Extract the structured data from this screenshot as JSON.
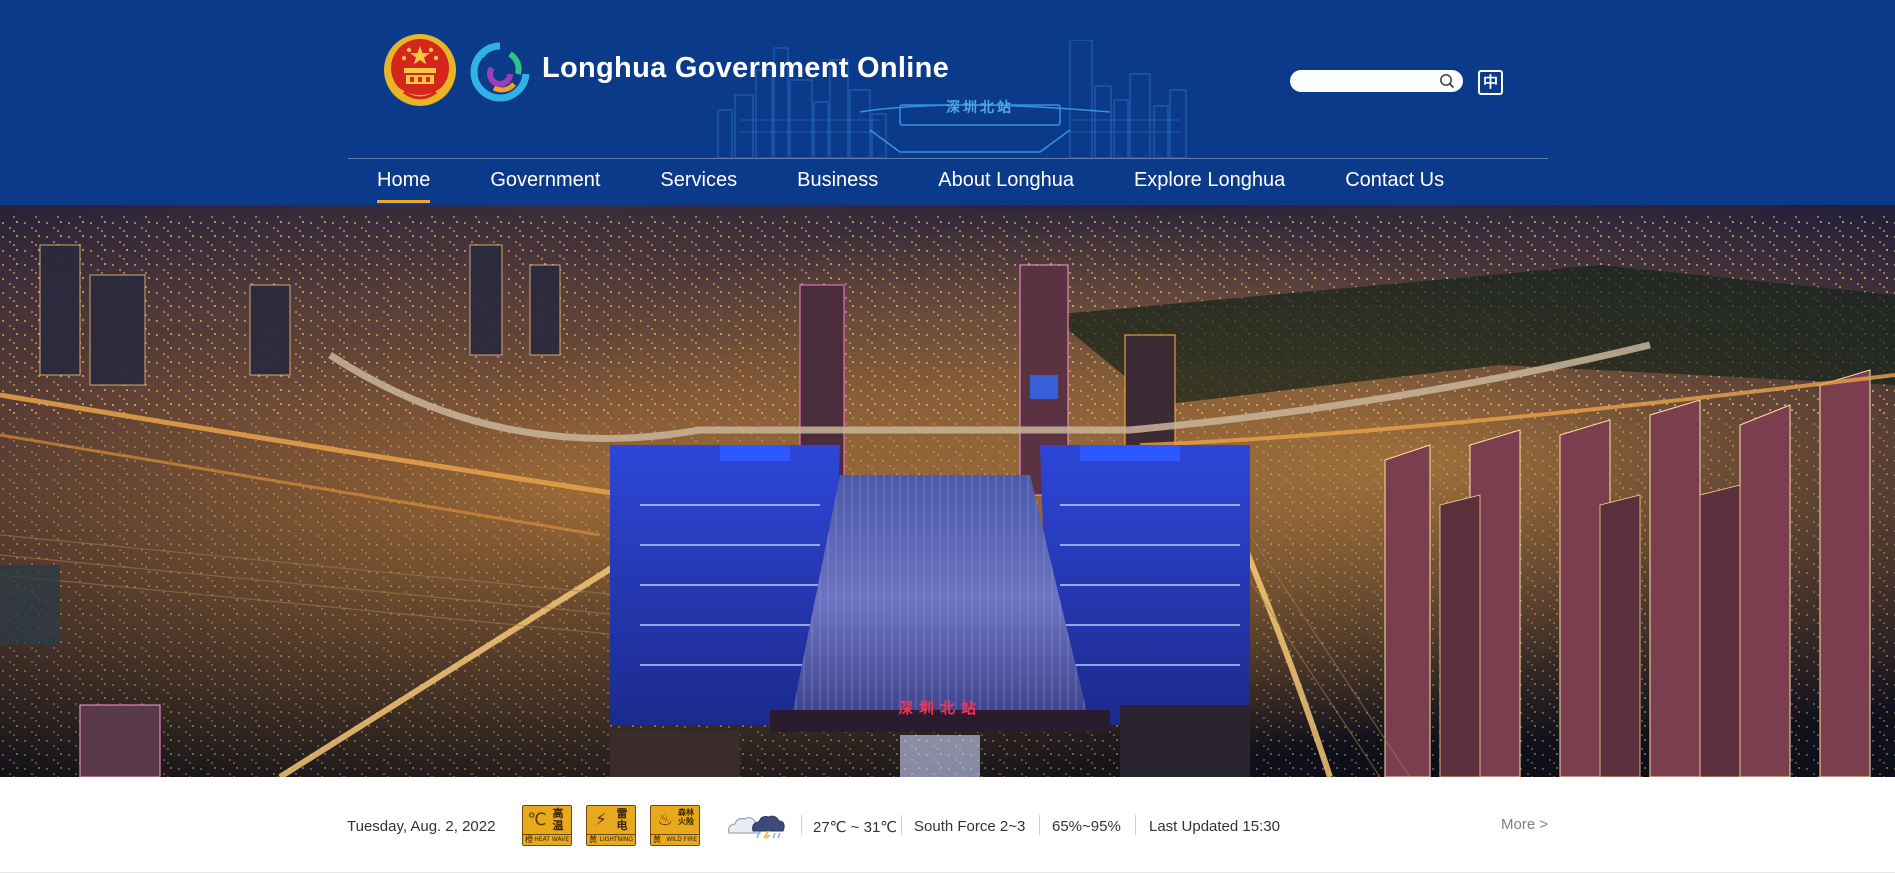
{
  "header": {
    "title": "Longhua Government Online",
    "station_caption": "深圳北站",
    "emblem_icon": "national-emblem-icon",
    "logo_icon": "longhua-logo-icon",
    "search": {
      "placeholder": "",
      "icon": "search-icon"
    },
    "language_button": "中"
  },
  "nav": {
    "items": [
      {
        "label": "Home",
        "active": true
      },
      {
        "label": "Government",
        "active": false
      },
      {
        "label": "Services",
        "active": false
      },
      {
        "label": "Business",
        "active": false
      },
      {
        "label": "About Longhua",
        "active": false
      },
      {
        "label": "Explore Longhua",
        "active": false
      },
      {
        "label": "Contact Us",
        "active": false
      }
    ]
  },
  "hero": {
    "station_sign": "深圳北站",
    "description": "Night aerial view of Shenzhen North Railway Station"
  },
  "info_bar": {
    "date": "Tuesday, Aug. 2, 2022",
    "warnings": [
      {
        "icon": "heat-warning-icon",
        "glyph": "℃",
        "cn": "高温",
        "level": "橙",
        "en": "HEAT WAVE"
      },
      {
        "icon": "lightning-warning-icon",
        "glyph": "⚡",
        "cn": "雷电",
        "level": "黄",
        "en": "LIGHTNING"
      },
      {
        "icon": "wildfire-warning-icon",
        "glyph": "♨",
        "cn": "森林火险",
        "level": "黄",
        "en": "WILD FIRE"
      }
    ],
    "weather_icon": "cloudy-thunderstorm-icon",
    "temperature": "27℃ ~ 31℃",
    "wind": "South Force 2~3",
    "humidity": "65%~95%",
    "updated": "Last Updated 15:30",
    "more": "More >"
  },
  "colors": {
    "header_bg": "#0b3a8a",
    "nav_active_underline": "#f5a623",
    "warning_yellow": "#e9a91f",
    "station_sign_red": "#ff2f4f"
  }
}
